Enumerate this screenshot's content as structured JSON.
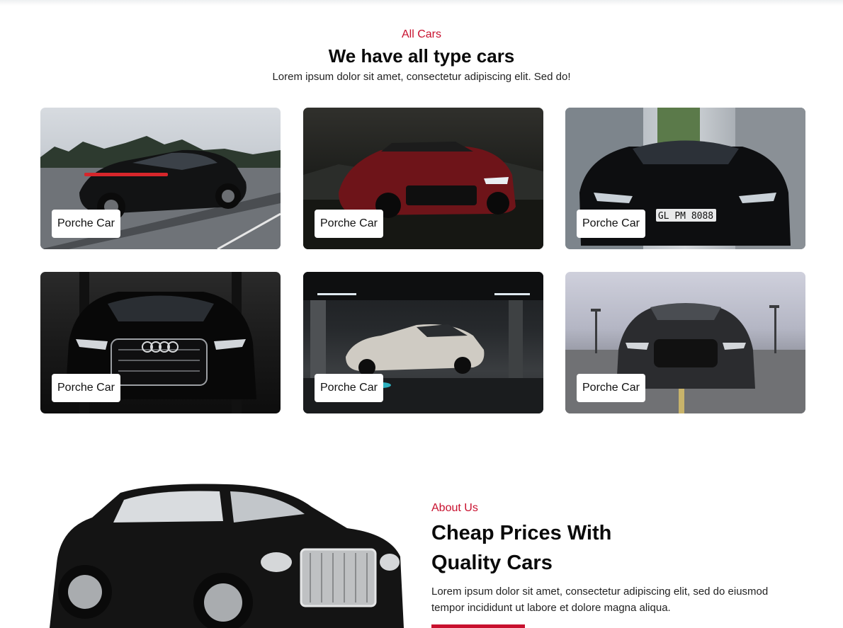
{
  "cars_section": {
    "eyebrow": "All Cars",
    "title": "We have all type cars",
    "subtitle": "Lorem ipsum dolor sit amet, consectetur adipiscing elit. Sed do!",
    "cards": [
      {
        "label": "Porche Car"
      },
      {
        "label": "Porche Car"
      },
      {
        "label": "Porche Car"
      },
      {
        "label": "Porche Car"
      },
      {
        "label": "Porche Car"
      },
      {
        "label": "Porche Car"
      }
    ]
  },
  "about_section": {
    "eyebrow": "About Us",
    "title_line1": "Cheap Prices With",
    "title_line2": "Quality Cars",
    "text": "Lorem ipsum dolor sit amet, consectetur adipiscing elit, sed do eiusmod tempor incididunt ut labore et dolore magna aliqua."
  },
  "colors": {
    "accent": "#c8102e",
    "text": "#111111",
    "background": "#ffffff"
  }
}
